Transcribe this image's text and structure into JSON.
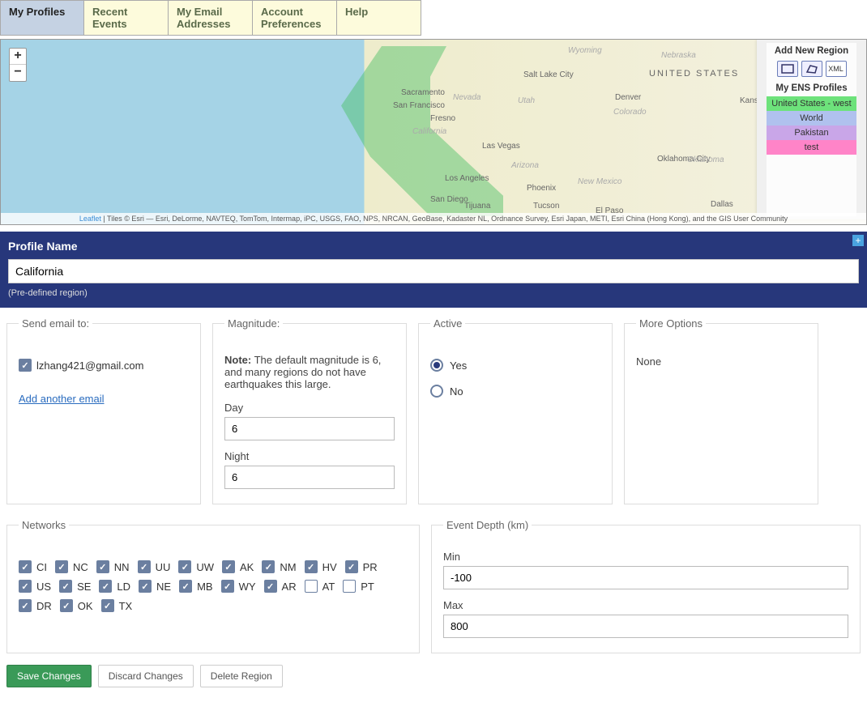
{
  "tabs": {
    "my_profiles": "My Profiles",
    "recent_events": "Recent Events",
    "my_email": "My Email Addresses",
    "account_prefs": "Account Preferences",
    "help": "Help"
  },
  "map": {
    "zoom_in": "+",
    "zoom_out": "−",
    "attrib_leaflet": "Leaflet",
    "attrib_rest": " | Tiles © Esri — Esri, DeLorme, NAVTEQ, TomTom, Intermap, iPC, USGS, FAO, NPS, NRCAN, GeoBase, Kadaster NL, Ordnance Survey, Esri Japan, METI, Esri China (Hong Kong), and the GIS User Community",
    "labels": {
      "us": "UNITED STATES",
      "salt_lake": "Salt Lake City",
      "denver": "Denver",
      "kansas": "Kansas",
      "okc": "Oklahoma City",
      "dallas": "Dallas",
      "el_paso": "El Paso",
      "phoenix": "Phoenix",
      "tucson": "Tucson",
      "vegas": "Las Vegas",
      "la": "Los Angeles",
      "sd": "San Diego",
      "tj": "Tijuana",
      "sac": "Sacramento",
      "sf": "San Francisco",
      "fresno": "Fresno",
      "wyoming": "Wyoming",
      "nebraska": "Nebraska",
      "nevada": "Nevada",
      "utah": "Utah",
      "california": "California",
      "colorado": "Colorado",
      "nm": "New Mexico",
      "ok": "Oklahoma",
      "arizona": "Arizona"
    },
    "panel": {
      "add_title": "Add New Region",
      "xml": "XML",
      "my_profiles": "My ENS Profiles",
      "items": {
        "us_west": "United States - west",
        "world": "World",
        "pakistan": "Pakistan",
        "test": "test"
      }
    }
  },
  "profile": {
    "label": "Profile Name",
    "value": "California",
    "sub": "(Pre-defined region)",
    "plus": "+"
  },
  "email": {
    "legend": "Send email to:",
    "addr": "lzhang421@gmail.com",
    "add_link": "Add another email"
  },
  "magnitude": {
    "legend": "Magnitude:",
    "note_b": "Note:",
    "note_t": " The default magnitude is 6, and many regions do not have earthquakes this large.",
    "day_lbl": "Day",
    "day_val": "6",
    "night_lbl": "Night",
    "night_val": "6"
  },
  "active": {
    "legend": "Active",
    "yes": "Yes",
    "no": "No"
  },
  "more": {
    "legend": "More Options",
    "none": "None"
  },
  "networks": {
    "legend": "Networks",
    "items": [
      "CI",
      "NC",
      "NN",
      "UU",
      "UW",
      "AK",
      "NM",
      "HV",
      "PR",
      "US",
      "SE",
      "LD",
      "NE",
      "MB",
      "WY",
      "AR",
      "AT",
      "PT",
      "DR",
      "OK",
      "TX"
    ],
    "unchecked": [
      "AT",
      "PT"
    ]
  },
  "depth": {
    "legend": "Event Depth (km)",
    "min_lbl": "Min",
    "min_val": "-100",
    "max_lbl": "Max",
    "max_val": "800"
  },
  "buttons": {
    "save": "Save Changes",
    "discard": "Discard Changes",
    "delete": "Delete Region"
  }
}
